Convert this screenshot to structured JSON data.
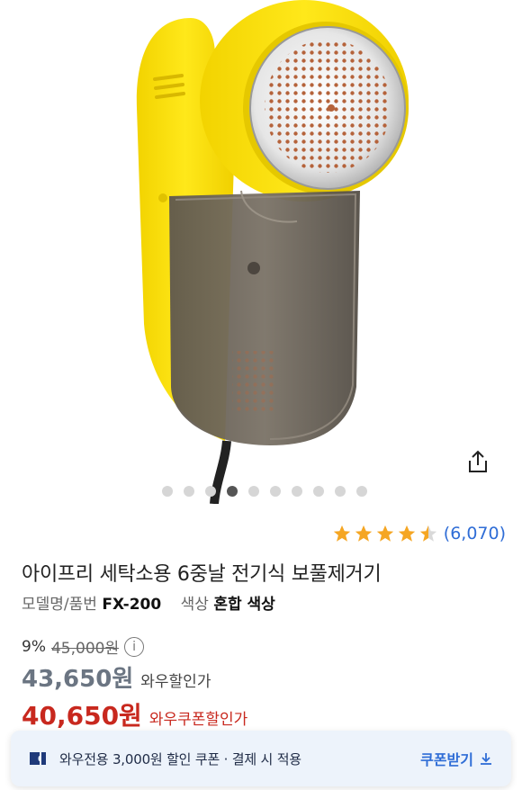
{
  "product": {
    "title": "아이프리 세탁소용 6중날 전기식 보풀제거기",
    "model_label": "모델명/품번",
    "model_value": "FX-200",
    "color_label": "색상",
    "color_value": "혼합 색상"
  },
  "gallery": {
    "image_count": 10,
    "active_index": 3
  },
  "rating": {
    "stars": 4.5,
    "review_count": "(6,070)"
  },
  "pricing": {
    "discount_rate": "9%",
    "original_price": "45,000원",
    "wow_price": "43,650원",
    "wow_label": "와우할인가",
    "coupon_price": "40,650원",
    "coupon_label": "와우쿠폰할인가"
  },
  "coupon_bar": {
    "text": "와우전용 3,000원 할인 쿠폰 · 결제 시 적용",
    "button_label": "쿠폰받기"
  },
  "icons": [
    "share-icon",
    "star-icon",
    "info-icon",
    "coupon-icon",
    "download-icon"
  ],
  "colors": {
    "star": "#f5a623",
    "link_blue": "#2f6dd6",
    "coupon_red": "#c8281e",
    "coupon_bar_bg": "#edf3fb"
  }
}
